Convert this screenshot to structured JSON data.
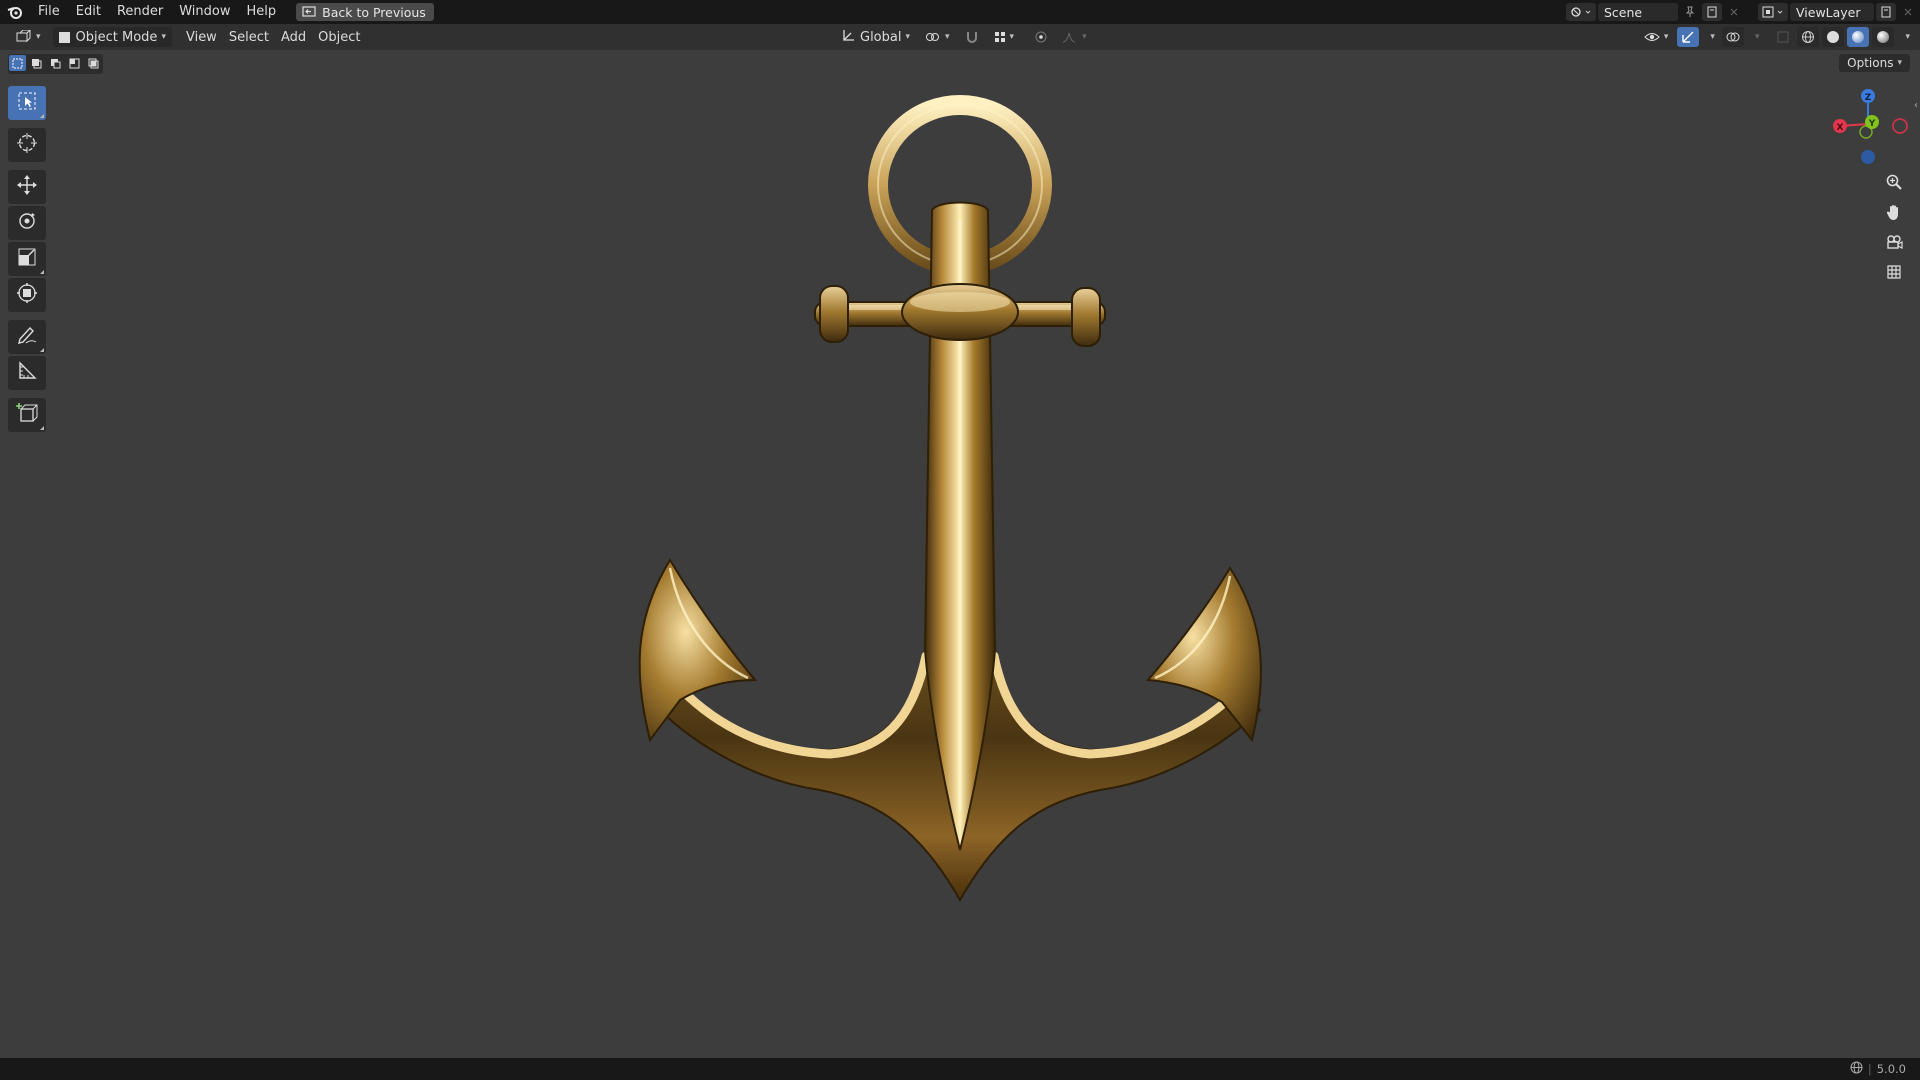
{
  "menu": {
    "items": [
      "File",
      "Edit",
      "Render",
      "Window",
      "Help"
    ],
    "back_label": "Back to Previous"
  },
  "top_right": {
    "scene_label": "Scene",
    "view_layer_label": "ViewLayer"
  },
  "viewport_header": {
    "mode_label": "Object Mode",
    "menus": [
      "View",
      "Select",
      "Add",
      "Object"
    ],
    "orientation_label": "Global",
    "options_label": "Options"
  },
  "gizmo": {
    "z_label": "Z",
    "y_label": "Y",
    "x_label": "X"
  },
  "status": {
    "version": "5.0.0"
  },
  "colors": {
    "accent": "#4772b3",
    "axis_x": "#e2364d",
    "axis_y": "#82c31e",
    "axis_z": "#3a7be0",
    "viewport_bg": "#3d3d3d",
    "gold": "#b8913c"
  },
  "icons": {
    "blender_logo": "blender-logo-icon",
    "select_box": "select-box-icon",
    "cursor": "cursor-icon",
    "move": "move-icon",
    "rotate": "rotate-icon",
    "scale": "scale-icon",
    "transform": "transform-icon",
    "annotate": "annotate-icon",
    "measure": "measure-icon",
    "add_cube": "add-cube-icon",
    "zoom": "zoom-icon",
    "pan": "hand-icon",
    "camera": "camera-icon",
    "grid": "grid-icon"
  }
}
